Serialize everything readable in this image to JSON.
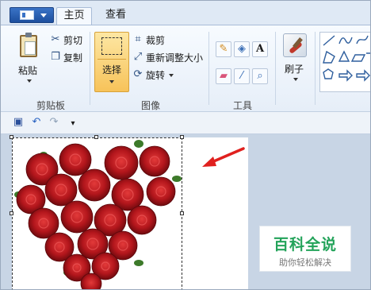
{
  "tabs": {
    "home": "主页",
    "view": "查看"
  },
  "clipboard": {
    "paste": "粘贴",
    "cut": "剪切",
    "copy": "复制",
    "group": "剪贴板"
  },
  "image": {
    "select": "选择",
    "crop": "裁剪",
    "resize": "重新调整大小",
    "rotate": "旋转",
    "group": "图像"
  },
  "tools": {
    "group": "工具",
    "text_tool": "A"
  },
  "brushes": {
    "label": "刷子"
  },
  "watermark": {
    "title": "百科全说",
    "subtitle": "助你轻松解决"
  },
  "colors": {
    "accent_select": "#f7c35a",
    "arrow": "#e0201e",
    "rose": "#b3161c",
    "watermark_green": "#23a35a"
  }
}
